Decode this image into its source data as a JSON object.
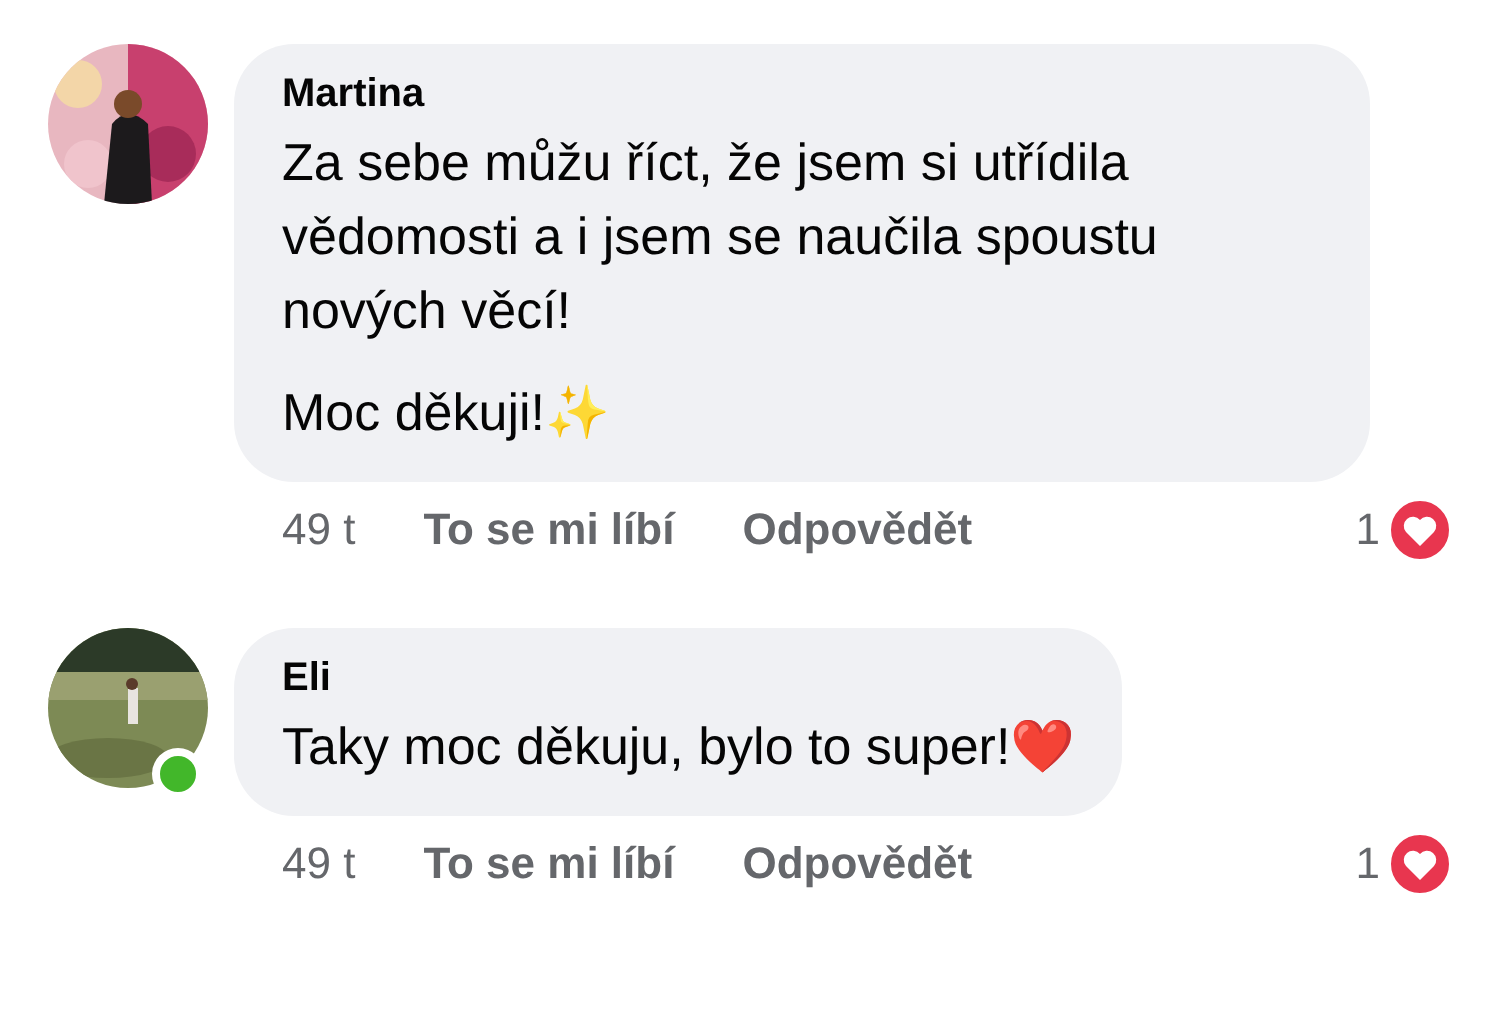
{
  "comments": [
    {
      "author": "Martina",
      "paragraphs": [
        "Za sebe můžu říct, že jsem si utřídila vědomosti a i jsem se naučila spoustu nových věcí!",
        "Moc děkuji!✨"
      ],
      "online": false,
      "time": "49 t",
      "like": "To se mi líbí",
      "reply": "Odpovědět",
      "reactions": "1"
    },
    {
      "author": "Eli",
      "paragraphs": [
        "Taky moc děkuju, bylo to super!❤️"
      ],
      "online": true,
      "time": "49 t",
      "like": "To se mi líbí",
      "reply": "Odpovědět",
      "reactions": "1"
    }
  ]
}
